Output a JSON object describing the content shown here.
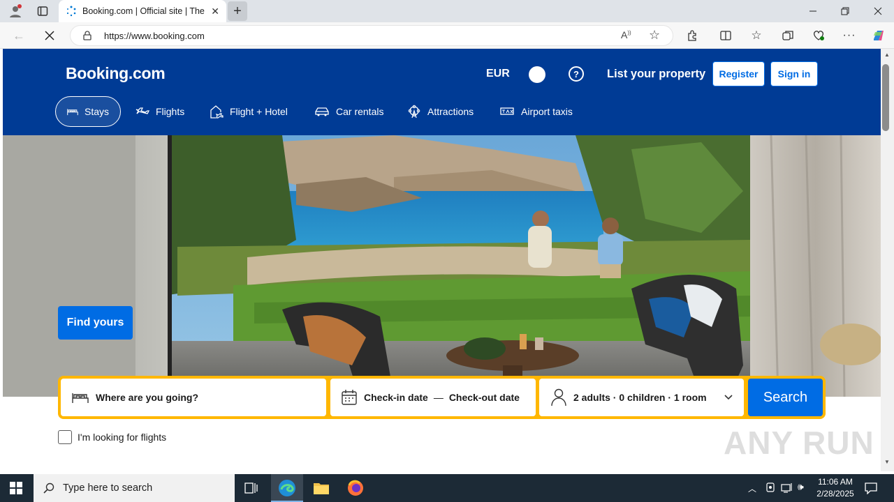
{
  "browser": {
    "tab_title": "Booking.com | Official site | The b",
    "url": "https://www.booking.com"
  },
  "header": {
    "logo": "Booking.com",
    "currency": "EUR",
    "list_property": "List your property",
    "register": "Register",
    "sign_in": "Sign in"
  },
  "nav": {
    "stays": "Stays",
    "flights": "Flights",
    "flight_hotel": "Flight + Hotel",
    "car_rentals": "Car rentals",
    "attractions": "Attractions",
    "airport_taxis": "Airport taxis"
  },
  "hero": {
    "find_button": "Find yours"
  },
  "search": {
    "destination_placeholder": "Where are you going?",
    "checkin": "Check-in date",
    "separator": "—",
    "checkout": "Check-out date",
    "occupancy": "2 adults · 0 children · 1 room",
    "search_button": "Search",
    "flights_checkbox": "I'm looking for flights"
  },
  "taskbar": {
    "search_placeholder": "Type here to search",
    "time": "11:06 AM",
    "date": "2/28/2025"
  },
  "watermark": "ANY RUN",
  "colors": {
    "brand_blue": "#003b95",
    "action_blue": "#006ce4",
    "search_border": "#ffb700"
  }
}
